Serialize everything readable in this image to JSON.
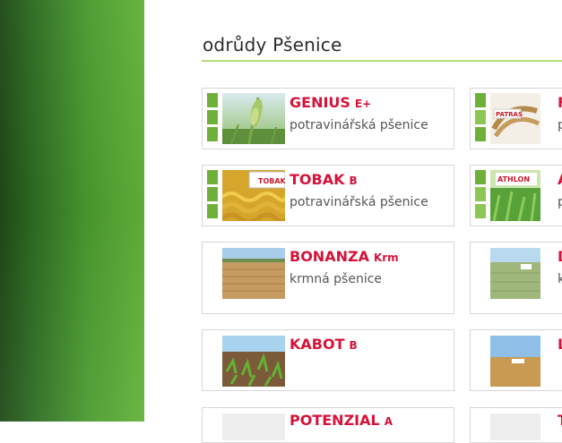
{
  "page": {
    "heading": "odrůdy Pšenice"
  },
  "varieties_left": [
    {
      "name": "GENIUS",
      "class": "E+",
      "type": "potravinářská pšenice"
    },
    {
      "name": "TOBAK",
      "class": "B",
      "type": "potravinářská pšenice"
    },
    {
      "name": "BONANZA",
      "class": "Krm",
      "type": "krmná pšenice"
    },
    {
      "name": "KABOT",
      "class": "B",
      "type": ""
    },
    {
      "name": "POTENZIAL",
      "class": "A",
      "type": ""
    }
  ],
  "varieties_right": [
    {
      "name_fragment": "F",
      "type_fragment": "p",
      "image_label": "PATRAS"
    },
    {
      "name_fragment": "A",
      "type_fragment": "p",
      "image_label": "ATHLON"
    },
    {
      "name_fragment": "D",
      "type_fragment": "k"
    },
    {
      "name_fragment": "L",
      "type_fragment": ""
    },
    {
      "name_fragment": "T",
      "type_fragment": ""
    }
  ],
  "image_labels": {
    "tobak": "TOBAK"
  },
  "colors": {
    "accent_red": "#d5133a",
    "bar_green": "#6fb03b",
    "heading_line": "#b6dd7e"
  }
}
